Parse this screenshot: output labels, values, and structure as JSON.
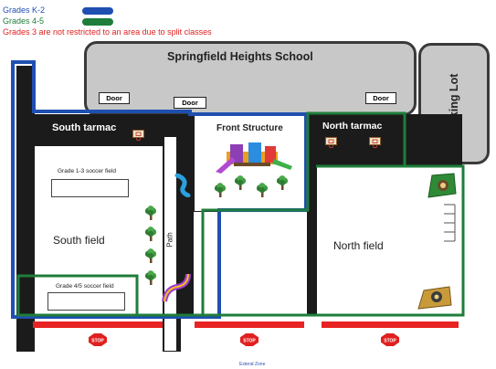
{
  "legend": {
    "k2_label": "Grades K-2",
    "k2_color": "#1f4fb0",
    "g45_label": "Grades 4-5",
    "g45_color": "#1e7d3a",
    "note": "Grades 3 are not restricted to an area due to split classes",
    "note_color": "#e02020"
  },
  "school": {
    "title": "Springfield Heights School",
    "doors": [
      "Door",
      "Door",
      "Door"
    ]
  },
  "parking": {
    "label": "Parking Lot"
  },
  "areas": {
    "south_tarmac": "South tarmac",
    "front_structure": "Front Structure",
    "north_tarmac": "North tarmac",
    "south_field": "South field",
    "north_field": "North field",
    "path": "Path",
    "soccer_13": "Grade 1-3 soccer field",
    "soccer_45": "Grade 4/5 soccer field"
  },
  "signs": {
    "stop": "STOP"
  },
  "footer": {
    "caption": "Extend Zone"
  },
  "icons": {
    "tree": "tree-icon",
    "hoop": "basketball-hoop-icon",
    "slide": "slide-icon",
    "stop": "stop-sign-icon",
    "climber": "climbing-structure-icon",
    "gaga": "activity-equipment-icon"
  }
}
